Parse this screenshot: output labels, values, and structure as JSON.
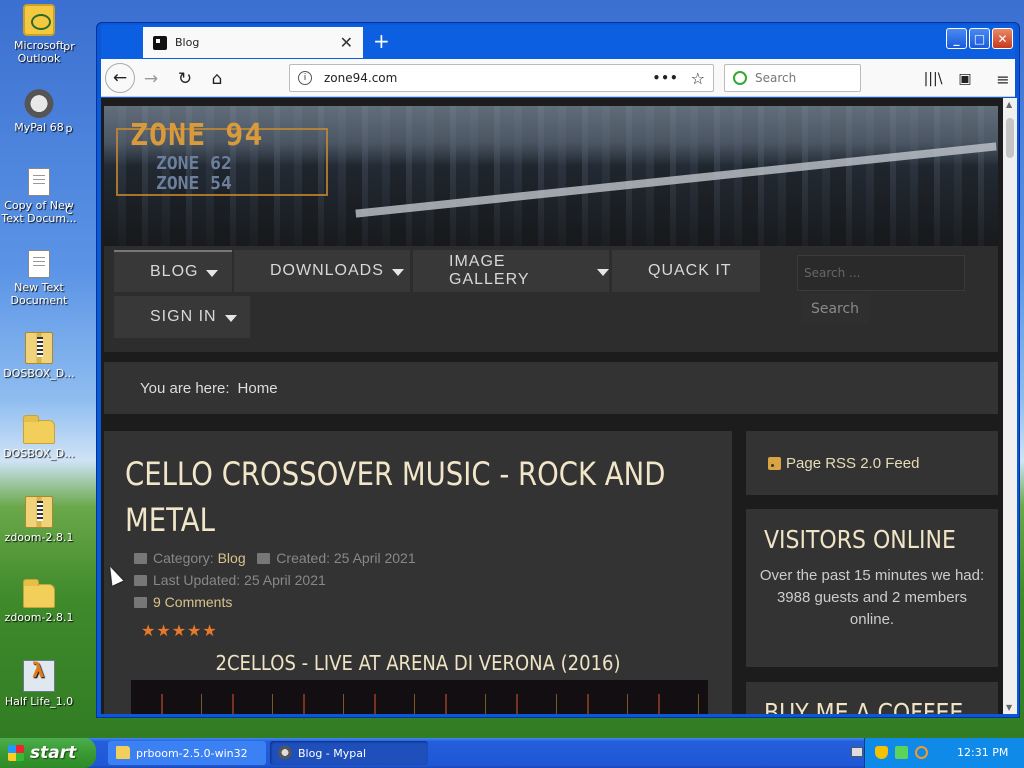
{
  "desktop": {
    "icons": [
      {
        "label": "Microsoft Outlook",
        "icon": "outlook-icon"
      },
      {
        "label": "MyPal 68",
        "icon": "mypal-icon"
      },
      {
        "label": "Copy of New Text Docum...",
        "icon": "text-document-icon"
      },
      {
        "label": "New Text Document",
        "icon": "text-document-icon"
      },
      {
        "label": "DOSBOX_D...",
        "icon": "zip-folder-icon"
      },
      {
        "label": "DOSBOX_D...",
        "icon": "folder-icon"
      },
      {
        "label": "zdoom-2.8.1",
        "icon": "zip-folder-icon"
      },
      {
        "label": "zdoom-2.8.1",
        "icon": "folder-icon"
      },
      {
        "label": "Half Life_1.0",
        "icon": "half-life-icon"
      }
    ],
    "partial_labels": [
      "pr",
      "p",
      "C"
    ]
  },
  "browser": {
    "tab_title": "Blog",
    "new_tab_label": "+",
    "url": "zone94.com",
    "search_placeholder": "Search",
    "window_buttons": {
      "minimize": "_",
      "maximize": "□",
      "close": "✕"
    }
  },
  "site": {
    "logo_main": "ZONE 94",
    "logo_sub": [
      "ZONE 62",
      "ZONE 54"
    ],
    "menu": [
      {
        "label": "BLOG",
        "has_caret": true
      },
      {
        "label": "DOWNLOADS",
        "has_caret": true
      },
      {
        "label": "IMAGE GALLERY",
        "has_caret": true
      },
      {
        "label": "QUACK IT",
        "has_caret": false
      },
      {
        "label": "SIGN IN",
        "has_caret": true
      }
    ],
    "search_placeholder": "Search ...",
    "search_button": "Search",
    "breadcrumb_prefix": "You are here:",
    "breadcrumb_current": "Home"
  },
  "article": {
    "title": "CELLO CROSSOVER MUSIC - ROCK AND METAL",
    "category_label": "Category:",
    "category": "Blog",
    "created": "Created: 25 April 2021",
    "updated": "Last Updated: 25 April 2021",
    "comments": "9 Comments",
    "rating_stars": "★★★★★",
    "rating": 5,
    "subheading": "2CELLOS - LIVE AT ARENA DI VERONA (2016)"
  },
  "sidebar": {
    "rss": "Page RSS 2.0 Feed",
    "visitors_title": "VISITORS ONLINE",
    "visitors_text": "Over the past 15 minutes we had: 3988 guests and 2 members online.",
    "coffee_title": "BUY ME A COFFEE"
  },
  "taskbar": {
    "start": "start",
    "tasks": [
      "prboom-2.5.0-win32",
      "Blog - Mypal"
    ],
    "clock": "12:31 PM"
  }
}
